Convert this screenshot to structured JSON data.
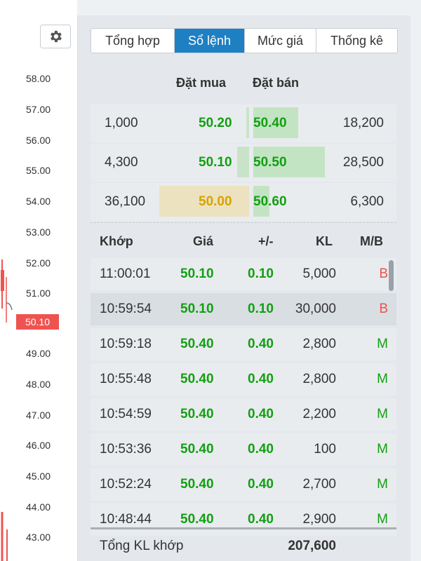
{
  "chart": {
    "axis_labels": [
      "58.00",
      "57.00",
      "56.00",
      "55.00",
      "54.00",
      "53.00",
      "52.00",
      "51.00",
      "50.10",
      "49.00",
      "48.00",
      "47.00",
      "46.00",
      "45.00",
      "44.00",
      "43.00"
    ],
    "current_price": "50.10",
    "colors": {
      "price_tag": "#ef5350"
    }
  },
  "tabs": [
    {
      "label": "Tổng hợp",
      "active": false
    },
    {
      "label": "Sổ lệnh",
      "active": true
    },
    {
      "label": "Mức giá",
      "active": false
    },
    {
      "label": "Thống kê",
      "active": false
    }
  ],
  "orderbook": {
    "bid_header": "Đặt mua",
    "ask_header": "Đặt bán",
    "rows": [
      {
        "bid_vol": "1,000",
        "bid_price": "50.20",
        "ask_price": "50.40",
        "ask_vol": "18,200",
        "bid_depth": 0.03,
        "ask_depth": 0.5
      },
      {
        "bid_vol": "4,300",
        "bid_price": "50.10",
        "ask_price": "50.50",
        "ask_vol": "28,500",
        "bid_depth": 0.13,
        "ask_depth": 0.8
      },
      {
        "bid_vol": "36,100",
        "bid_price": "50.00",
        "ask_price": "50.60",
        "ask_vol": "6,300",
        "bid_depth": 1.0,
        "ask_depth": 0.18
      }
    ]
  },
  "trades": {
    "headers": {
      "time": "Khớp",
      "price": "Giá",
      "change": "+/-",
      "volume": "KL",
      "side": "M/B"
    },
    "rows": [
      {
        "time": "11:00:01",
        "price": "50.10",
        "change": "0.10",
        "volume": "5,000",
        "side": "B"
      },
      {
        "time": "10:59:54",
        "price": "50.10",
        "change": "0.10",
        "volume": "30,000",
        "side": "B"
      },
      {
        "time": "10:59:18",
        "price": "50.40",
        "change": "0.40",
        "volume": "2,800",
        "side": "M"
      },
      {
        "time": "10:55:48",
        "price": "50.40",
        "change": "0.40",
        "volume": "2,800",
        "side": "M"
      },
      {
        "time": "10:54:59",
        "price": "50.40",
        "change": "0.40",
        "volume": "2,200",
        "side": "M"
      },
      {
        "time": "10:53:36",
        "price": "50.40",
        "change": "0.40",
        "volume": "100",
        "side": "M"
      },
      {
        "time": "10:52:24",
        "price": "50.40",
        "change": "0.40",
        "volume": "2,700",
        "side": "M"
      },
      {
        "time": "10:48:44",
        "price": "50.40",
        "change": "0.40",
        "volume": "2,900",
        "side": "M"
      }
    ],
    "total_label": "Tổng KL khớp",
    "total_value": "207,600"
  },
  "icons": {
    "settings": "gear-icon"
  }
}
